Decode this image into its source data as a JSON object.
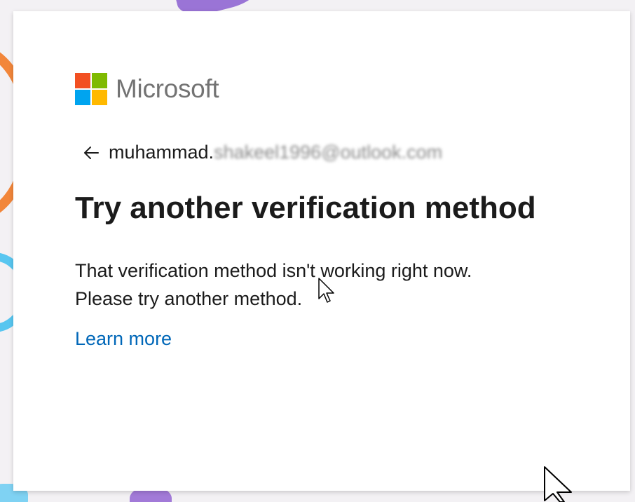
{
  "brand": {
    "name": "Microsoft",
    "logo_colors": [
      "#f25022",
      "#7fba00",
      "#00a4ef",
      "#ffb900"
    ]
  },
  "identity": {
    "back_icon": "back-arrow-icon",
    "email_visible": "muhammad.",
    "email_redacted": "shakeel1996@outlook.com"
  },
  "content": {
    "title": "Try another verification method",
    "description_line1": "That verification method isn't working right now.",
    "description_line2": "Please try another method.",
    "learn_more": "Learn more"
  },
  "colors": {
    "link": "#0067b8",
    "text": "#1b1b1b",
    "logo_text": "#737373"
  }
}
